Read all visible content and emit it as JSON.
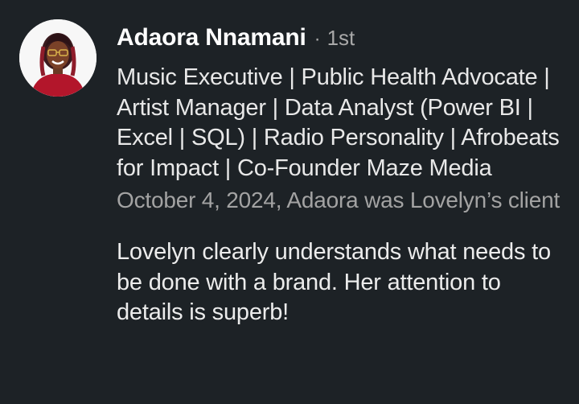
{
  "recommendation": {
    "author": {
      "name": "Adaora Nnamani",
      "separator": "·",
      "connection_degree": "1st",
      "headline": "Music Executive | Public Health Advocate | Artist Manager | Data Analyst (Power BI | Excel | SQL) | Radio Personality | Afrobeats for Impact | Co-Founder Maze Media",
      "avatar_icon": "profile-photo"
    },
    "meta": "October 4, 2024, Adaora was Lovelyn’s client",
    "text": "Lovelyn clearly understands what needs to be done with a brand. Her attention to details is superb!"
  },
  "colors": {
    "background": "#1d2226",
    "primary_text": "#ffffff",
    "secondary_text": "#a3a3a3"
  }
}
